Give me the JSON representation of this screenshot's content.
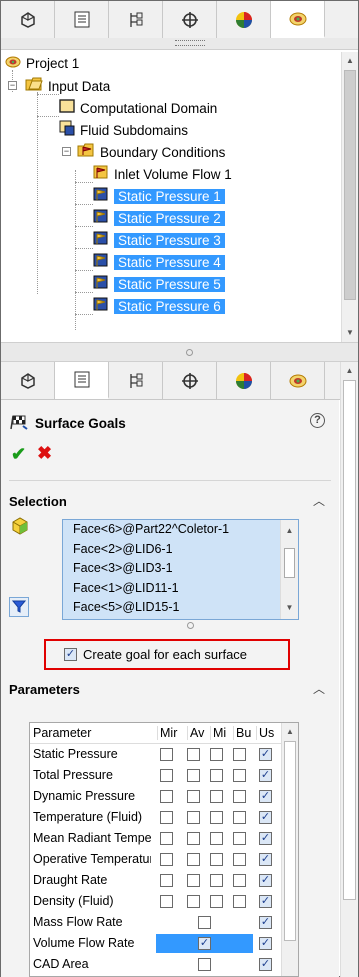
{
  "top_tabs": [
    {
      "icon": "feature-manager-icon"
    },
    {
      "icon": "property-manager-icon"
    },
    {
      "icon": "configuration-manager-icon"
    },
    {
      "icon": "dimxpert-icon"
    },
    {
      "icon": "display-manager-icon"
    },
    {
      "icon": "flow-simulation-icon"
    }
  ],
  "tree": {
    "project": "Project 1",
    "input_data": "Input Data",
    "computational_domain": "Computational Domain",
    "fluid_subdomains": "Fluid Subdomains",
    "boundary_conditions": "Boundary Conditions",
    "inlet": "Inlet Volume Flow 1",
    "static_pressures": [
      "Static Pressure 1",
      "Static Pressure 2",
      "Static Pressure 3",
      "Static Pressure 4",
      "Static Pressure 5",
      "Static Pressure 6"
    ]
  },
  "property_manager": {
    "title": "Surface Goals",
    "help": "?",
    "ok": "✔",
    "cancel": "✖",
    "selection": {
      "header": "Selection",
      "faces": [
        "Face<6>@Part22^Coletor-1",
        "Face<2>@LID6-1",
        "Face<3>@LID3-1",
        "Face<1>@LID11-1",
        "Face<5>@LID15-1"
      ]
    },
    "create_goal": {
      "label": "Create goal for each surface",
      "checked": true
    },
    "parameters": {
      "header": "Parameters",
      "columns": [
        "Parameter",
        "Mir",
        "Av",
        "Mi",
        "Bu",
        "Us"
      ],
      "rows": [
        {
          "name": "Static Pressure",
          "min": false,
          "av": false,
          "max": false,
          "bulk": false,
          "use": true
        },
        {
          "name": "Total Pressure",
          "min": false,
          "av": false,
          "max": false,
          "bulk": false,
          "use": true
        },
        {
          "name": "Dynamic Pressure",
          "min": false,
          "av": false,
          "max": false,
          "bulk": false,
          "use": true
        },
        {
          "name": "Temperature (Fluid)",
          "min": false,
          "av": false,
          "max": false,
          "bulk": false,
          "use": true
        },
        {
          "name": "Mean Radiant Temperature",
          "min": false,
          "av": false,
          "max": false,
          "bulk": false,
          "use": true
        },
        {
          "name": "Operative Temperature",
          "min": false,
          "av": false,
          "max": false,
          "bulk": false,
          "use": true
        },
        {
          "name": "Draught Rate",
          "min": false,
          "av": false,
          "max": false,
          "bulk": false,
          "use": true
        },
        {
          "name": "Density (Fluid)",
          "min": false,
          "av": false,
          "max": false,
          "bulk": false,
          "use": true
        },
        {
          "name": "Mass Flow Rate",
          "single": true,
          "value": false,
          "use": true
        },
        {
          "name": "Volume Flow Rate",
          "single": true,
          "value": true,
          "use": true,
          "highlighted": true
        },
        {
          "name": "CAD Area",
          "single": true,
          "value": false,
          "use": true
        }
      ]
    }
  }
}
